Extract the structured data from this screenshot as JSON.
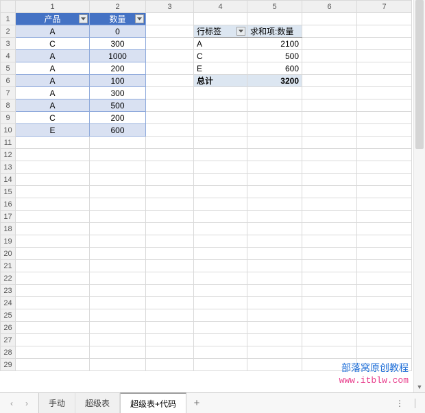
{
  "columns": [
    "1",
    "2",
    "3",
    "4",
    "5",
    "6",
    "7"
  ],
  "rows": [
    "1",
    "2",
    "3",
    "4",
    "5",
    "6",
    "7",
    "8",
    "9",
    "10",
    "11",
    "12",
    "13",
    "14",
    "15",
    "16",
    "17",
    "18",
    "19",
    "20",
    "21",
    "22",
    "23",
    "24",
    "25",
    "26",
    "27",
    "28",
    "29"
  ],
  "table": {
    "headers": [
      "产品",
      "数量"
    ],
    "data": [
      [
        "A",
        "0"
      ],
      [
        "C",
        "300"
      ],
      [
        "A",
        "1000"
      ],
      [
        "A",
        "200"
      ],
      [
        "A",
        "100"
      ],
      [
        "A",
        "300"
      ],
      [
        "A",
        "500"
      ],
      [
        "C",
        "200"
      ],
      [
        "E",
        "600"
      ]
    ]
  },
  "pivot": {
    "row_header": "行标签",
    "val_header": "求和项:数量",
    "rows": [
      {
        "label": "A",
        "value": "2100"
      },
      {
        "label": "C",
        "value": "500"
      },
      {
        "label": "E",
        "value": "600"
      }
    ],
    "total": {
      "label": "总计",
      "value": "3200"
    }
  },
  "tabs": {
    "list": [
      "手动",
      "超级表",
      "超级表+代码"
    ],
    "active": 2,
    "add": "+"
  },
  "watermark": {
    "line1": "部落窝原创教程",
    "line2": "www.itblw.com"
  },
  "chart_data": {
    "type": "table",
    "title": "",
    "source_table": {
      "columns": [
        "产品",
        "数量"
      ],
      "rows": [
        [
          "A",
          0
        ],
        [
          "C",
          300
        ],
        [
          "A",
          1000
        ],
        [
          "A",
          200
        ],
        [
          "A",
          100
        ],
        [
          "A",
          300
        ],
        [
          "A",
          500
        ],
        [
          "C",
          200
        ],
        [
          "E",
          600
        ]
      ]
    },
    "pivot_table": {
      "columns": [
        "行标签",
        "求和项:数量"
      ],
      "rows": [
        [
          "A",
          2100
        ],
        [
          "C",
          500
        ],
        [
          "E",
          600
        ]
      ],
      "total": [
        "总计",
        3200
      ]
    }
  }
}
